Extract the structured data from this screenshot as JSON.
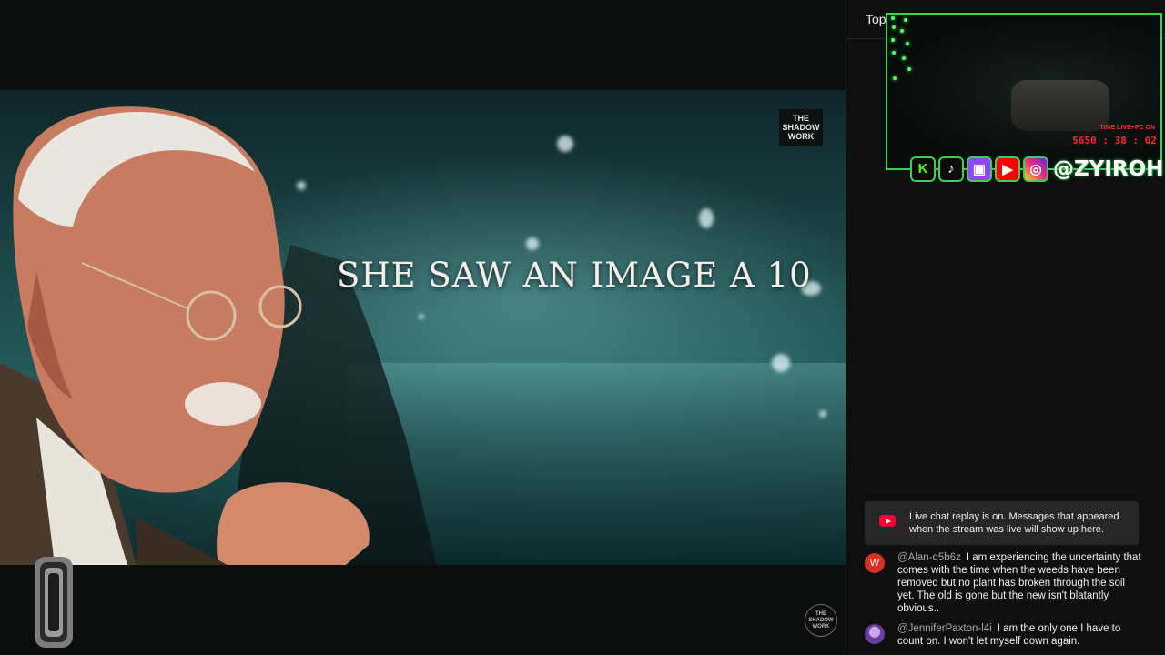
{
  "video": {
    "caption": "SHE SAW AN IMAGE A 10",
    "watermark_top": [
      "THE",
      "SHADOW",
      "WORK"
    ],
    "watermark_bottom": [
      "THE",
      "SHADOW",
      "WORK"
    ]
  },
  "chat": {
    "header_title": "Top",
    "replay_notice": "Live chat replay is on. Messages that appeared when the stream was live will show up here.",
    "messages": [
      {
        "avatar_letter": "W",
        "avatar_color": "#d93025",
        "author": "@Alan-q5b6z",
        "text": "I am experiencing the uncertainty that comes with the time when the weeds have been removed but no plant has broken through the soil yet. The old is gone but the new isn't blatantly obvious.."
      },
      {
        "avatar_letter": "",
        "avatar_color": "#7e57c2",
        "author": "@JenniferPaxton-l4i",
        "text": "I am the only one I have to count on. I won't let myself down again."
      }
    ]
  },
  "overlay": {
    "time_label": "TIME LIVE+PC ON",
    "time_value": "5650 : 38 : 02",
    "handle": "@ZYIROH",
    "social_icons": [
      "kick-icon",
      "tiktok-icon",
      "twitch-icon",
      "youtube-icon",
      "instagram-icon"
    ],
    "accent": "#39d353"
  }
}
